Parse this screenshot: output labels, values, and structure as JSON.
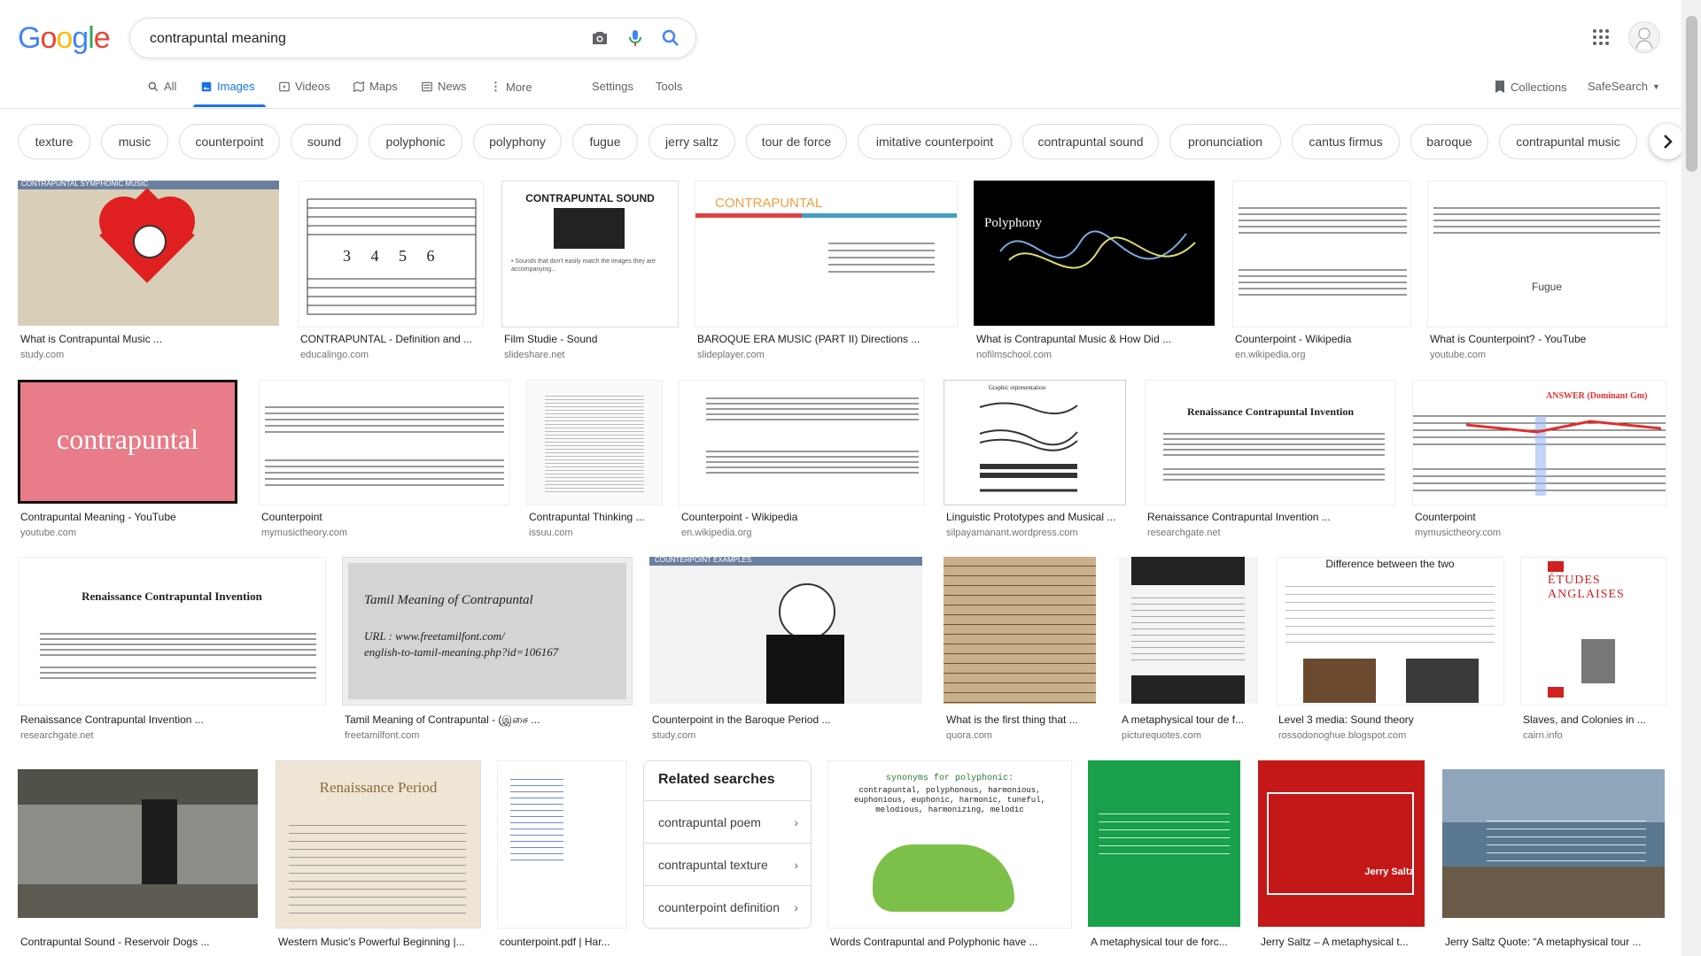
{
  "header": {
    "logo_letters": [
      "G",
      "o",
      "o",
      "g",
      "l",
      "e"
    ],
    "logo_colors": [
      "#4285f4",
      "#ea4335",
      "#fbbc05",
      "#4285f4",
      "#34a853",
      "#ea4335"
    ],
    "search_value": "contrapuntal meaning"
  },
  "nav": {
    "tabs": [
      {
        "label": "All",
        "icon": "search-icon"
      },
      {
        "label": "Images",
        "icon": "image-icon"
      },
      {
        "label": "Videos",
        "icon": "video-icon"
      },
      {
        "label": "Maps",
        "icon": "map-icon"
      },
      {
        "label": "News",
        "icon": "news-icon"
      },
      {
        "label": "More",
        "icon": "more-dots-icon"
      }
    ],
    "settings": "Settings",
    "tools": "Tools",
    "collections": "Collections",
    "safesearch": "SafeSearch"
  },
  "chips": [
    "texture",
    "music",
    "counterpoint",
    "sound",
    "polyphonic",
    "polyphony",
    "fugue",
    "jerry saltz",
    "tour de force",
    "imitative counterpoint",
    "contrapuntal sound",
    "pronunciation",
    "cantus firmus",
    "baroque",
    "contrapuntal music"
  ],
  "results": [
    {
      "title": "What is Contrapuntal Music ...",
      "source": "study.com",
      "thumb_text": "CONTRAPUNTAL SYMPHONIC MUSIC"
    },
    {
      "title": "CONTRAPUNTAL - Definition and ...",
      "source": "educalingo.com",
      "thumb_text": "3 4 5 6"
    },
    {
      "title": "Film Studie - Sound",
      "source": "slideshare.net",
      "thumb_text": "CONTRAPUNTAL SOUND"
    },
    {
      "title": "BAROQUE ERA MUSIC (PART II) Directions ...",
      "source": "slideplayer.com",
      "thumb_text": "CONTRAPUNTAL"
    },
    {
      "title": "What is Contrapuntal Music & How Did ...",
      "source": "nofilmschool.com",
      "thumb_text": "Polyphony"
    },
    {
      "title": "Counterpoint - Wikipedia",
      "source": "en.wikipedia.org",
      "thumb_text": ""
    },
    {
      "title": "What is Counterpoint? - YouTube",
      "source": "youtube.com",
      "thumb_text": "Fugue"
    },
    {
      "title": "Contrapuntal Meaning - YouTube",
      "source": "youtube.com",
      "thumb_text": "contrapuntal"
    },
    {
      "title": "Counterpoint",
      "source": "mymusictheory.com",
      "thumb_text": ""
    },
    {
      "title": "Contrapuntal Thinking ...",
      "source": "issuu.com",
      "thumb_text": ""
    },
    {
      "title": "Counterpoint - Wikipedia",
      "source": "en.wikipedia.org",
      "thumb_text": ""
    },
    {
      "title": "Linguistic Prototypes and Musical ...",
      "source": "silpayamanant.wordpress.com",
      "thumb_text": "Graphic representation"
    },
    {
      "title": "Renaissance Contrapuntal Invention ...",
      "source": "researchgate.net",
      "thumb_text": "Renaissance Contrapuntal Invention"
    },
    {
      "title": "Counterpoint",
      "source": "mymusictheory.com",
      "thumb_text": "ANSWER (Dominant Gm)"
    },
    {
      "title": "Renaissance Contrapuntal Invention ...",
      "source": "researchgate.net",
      "thumb_text": "Renaissance Contrapuntal Invention"
    },
    {
      "title": "Tamil Meaning of Contrapuntal - (இசை ...",
      "source": "freetamilfont.com",
      "thumb_text": "Tamil Meaning of Contrapuntal"
    },
    {
      "title": "Counterpoint in the Baroque Period ...",
      "source": "study.com",
      "thumb_text": "COUNTERPOINT EXAMPLES"
    },
    {
      "title": "What is the first thing that ...",
      "source": "quora.com",
      "thumb_text": ""
    },
    {
      "title": "A metaphysical tour de f...",
      "source": "picturequotes.com",
      "thumb_text": ""
    },
    {
      "title": "Level 3 media: Sound theory",
      "source": "rossodonoghue.blogspot.com",
      "thumb_text": "Difference between the two"
    },
    {
      "title": "Slaves, and Colonies in ...",
      "source": "cairn.info",
      "thumb_text": "ÉTUDES ANGLAISES"
    },
    {
      "title": "Contrapuntal Sound - Reservoir Dogs ...",
      "source": "",
      "thumb_text": ""
    },
    {
      "title": "Western Music's Powerful Beginning |...",
      "source": "",
      "thumb_text": "Renaissance Period"
    },
    {
      "title": "counterpoint.pdf | Har...",
      "source": "",
      "thumb_text": ""
    },
    {
      "title": "Words Contrapuntal and Polyphonic have ...",
      "source": "",
      "thumb_text": "synonyms for polyphonic:"
    },
    {
      "title": "A metaphysical tour de forc...",
      "source": "",
      "thumb_text": ""
    },
    {
      "title": "Jerry Saltz – A metaphysical t...",
      "source": "",
      "thumb_text": "Jerry Saltz"
    },
    {
      "title": "Jerry Saltz Quote: “A metaphysical tour ...",
      "source": "",
      "thumb_text": ""
    }
  ],
  "related": {
    "heading": "Related searches",
    "items": [
      "contrapuntal poem",
      "contrapuntal texture",
      "counterpoint definition"
    ]
  },
  "colors": {
    "accent": "#1a73e8",
    "link_gray": "#70757a",
    "border": "#dadce0"
  }
}
